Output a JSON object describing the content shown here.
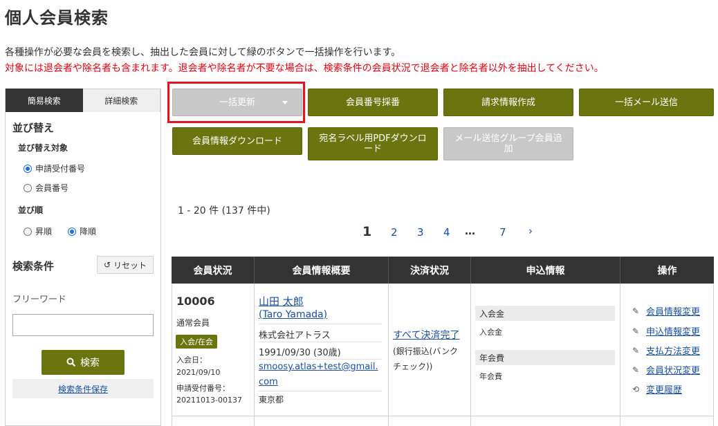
{
  "page": {
    "title": "個人会員検索",
    "description": "各種操作が必要な会員を検索し、抽出した会員に対して緑のボタンで一括操作を行います。",
    "warning": "対象には退会者や除名者も含まれます。退会者や除名者が不要な場合は、検索条件の会員状況で退会者と除名者以外を抽出してください。"
  },
  "sidebar": {
    "tabs": [
      {
        "label": "簡易検索",
        "active": true
      },
      {
        "label": "詳細検索",
        "active": false
      }
    ],
    "sort_heading": "並び替え",
    "sort_target_label": "並び替え対象",
    "sort_target_options": [
      {
        "label": "申請受付番号",
        "checked": true
      },
      {
        "label": "会員番号",
        "checked": false
      }
    ],
    "sort_order_label": "並び順",
    "sort_order_options": [
      {
        "label": "昇順",
        "checked": false
      },
      {
        "label": "降順",
        "checked": true
      }
    ],
    "conditions_heading": "検索条件",
    "reset_label": "リセット",
    "freeword_label": "フリーワード",
    "freeword_value": "",
    "search_label": "検索",
    "save_conditions_label": "検索条件保存"
  },
  "actions": {
    "bulk_update": "一括更新",
    "assign_number": "会員番号採番",
    "create_invoice": "請求情報作成",
    "bulk_mail": "一括メール送信",
    "download_info": "会員情報ダウンロード",
    "label_pdf": "宛名ラベル用PDFダウンロード",
    "add_mail_group": "メール送信グループ会員追加"
  },
  "results": {
    "count_text": "1 - 20 件 (137 件中)",
    "pages": [
      "1",
      "2",
      "3",
      "4",
      "…",
      "7",
      "›"
    ]
  },
  "table": {
    "headers": [
      "会員状況",
      "会員情報概要",
      "決済状況",
      "申込情報",
      "操作"
    ],
    "rows": [
      {
        "member_id": "10006",
        "member_type": "通常会員",
        "status_badge": "入会/在会",
        "join_date_label": "入会日：",
        "join_date": "2021/09/10",
        "application_no_label": "申請受付番号：",
        "application_no": "20211013-00137",
        "name": "山田 太郎",
        "name_en": "(Taro Yamada)",
        "company": "株式会社アトラス",
        "birth": "1991/09/30 (30歳)",
        "email_line1": "smoosy.atlas+test@gmail.",
        "email_line2": "com",
        "prefecture": "東京都",
        "payment_status": "すべて決済完了",
        "payment_method_line1": "(銀行振込(バンク",
        "payment_method_line2": "チェック))",
        "apply_items": [
          {
            "header": "入会金",
            "value": "入会金"
          },
          {
            "header": "年会費",
            "value": "年会費"
          }
        ],
        "operations": [
          {
            "label": "会員情報変更",
            "icon": "pencil-icon"
          },
          {
            "label": "申込情報変更",
            "icon": "pencil-icon"
          },
          {
            "label": "支払方法変更",
            "icon": "pencil-icon"
          },
          {
            "label": "会員状況変更",
            "icon": "pencil-icon"
          },
          {
            "label": "変更履歴",
            "icon": "history-icon"
          }
        ]
      }
    ]
  }
}
